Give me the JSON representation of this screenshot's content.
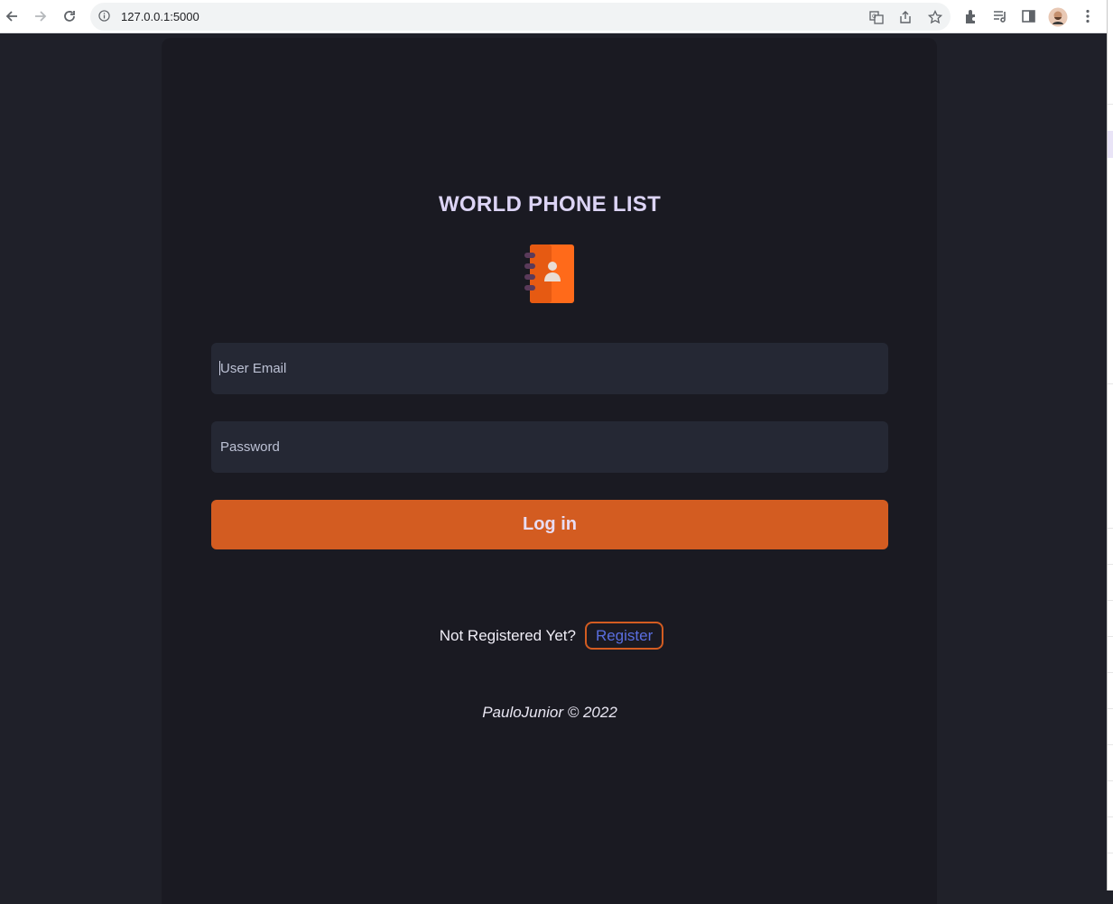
{
  "browser": {
    "url": "127.0.0.1:5000",
    "icons": [
      "back-icon",
      "forward-icon",
      "reload-icon",
      "info-icon",
      "translate-icon",
      "share-icon",
      "bookmark-star-icon",
      "extensions-icon",
      "reading-list-icon",
      "side-panel-icon",
      "profile-avatar",
      "menu-icon"
    ]
  },
  "page": {
    "title": "WORLD PHONE LIST",
    "logo_icon": "contact-book-icon",
    "email_placeholder": "User Email",
    "password_placeholder": "Password",
    "login_label": "Log in",
    "register_prompt": "Not Registered Yet?",
    "register_label": "Register",
    "footer": "PauloJunior © 2022"
  },
  "colors": {
    "background": "#1f2029",
    "card": "#1a1a22",
    "input": "#252834",
    "accent": "#d35c21",
    "title": "#dcd4f5",
    "link": "#5a6ee0"
  }
}
